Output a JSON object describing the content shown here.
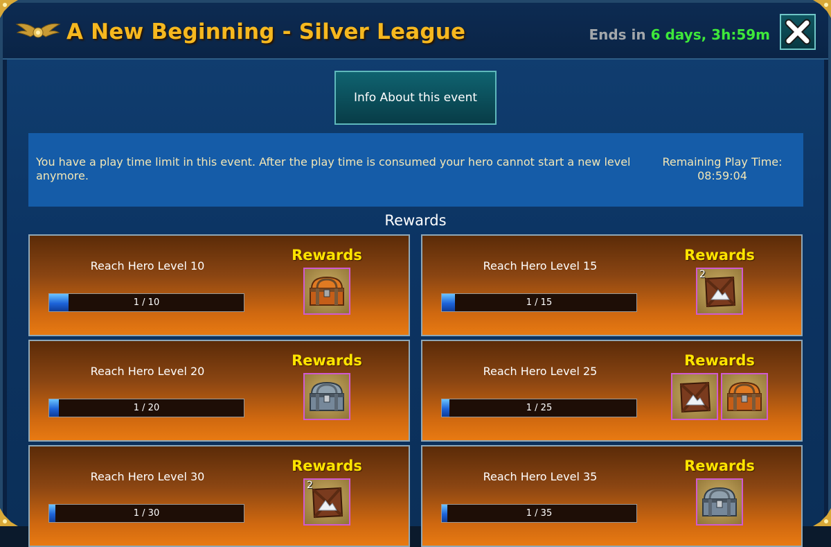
{
  "header": {
    "title": "A New Beginning - Silver League",
    "ends_label": "Ends in",
    "ends_value": "6 days, 3h:59m"
  },
  "info_button_label": "Info About this event",
  "notice": {
    "text": "You have a play time limit in this event. After the play time is consumed your hero cannot start a new level anymore.",
    "remaining_label": "Remaining Play Time:",
    "remaining_value": "08:59:04"
  },
  "rewards_heading": "Rewards",
  "cards": [
    {
      "label": "Reach Hero Level 10",
      "progress_text": "1 / 10",
      "progress_fraction": 0.1,
      "rewards_title": "Rewards",
      "rewards": [
        {
          "icon": "orange-chest-icon",
          "quantity": ""
        }
      ]
    },
    {
      "label": "Reach Hero Level 15",
      "progress_text": "1 / 15",
      "progress_fraction": 0.0667,
      "rewards_title": "Rewards",
      "rewards": [
        {
          "icon": "crate-icon",
          "quantity": "2"
        }
      ]
    },
    {
      "label": "Reach Hero Level 20",
      "progress_text": "1 / 20",
      "progress_fraction": 0.05,
      "rewards_title": "Rewards",
      "rewards": [
        {
          "icon": "silver-chest-icon",
          "quantity": ""
        }
      ]
    },
    {
      "label": "Reach Hero Level 25",
      "progress_text": "1 / 25",
      "progress_fraction": 0.04,
      "rewards_title": "Rewards",
      "rewards": [
        {
          "icon": "crate-icon",
          "quantity": ""
        },
        {
          "icon": "orange-chest-icon",
          "quantity": ""
        }
      ]
    },
    {
      "label": "Reach Hero Level 30",
      "progress_text": "1 / 30",
      "progress_fraction": 0.0333,
      "rewards_title": "Rewards",
      "rewards": [
        {
          "icon": "crate-icon",
          "quantity": "2"
        }
      ]
    },
    {
      "label": "Reach Hero Level 35",
      "progress_text": "1 / 35",
      "progress_fraction": 0.0286,
      "rewards_title": "Rewards",
      "rewards": [
        {
          "icon": "silver-chest-icon",
          "quantity": ""
        }
      ]
    }
  ],
  "colors": {
    "title": "#f6b81f",
    "ends_value": "#3ee83a",
    "rewards_title": "#ffe400",
    "notice_bg": "#155ca8"
  }
}
